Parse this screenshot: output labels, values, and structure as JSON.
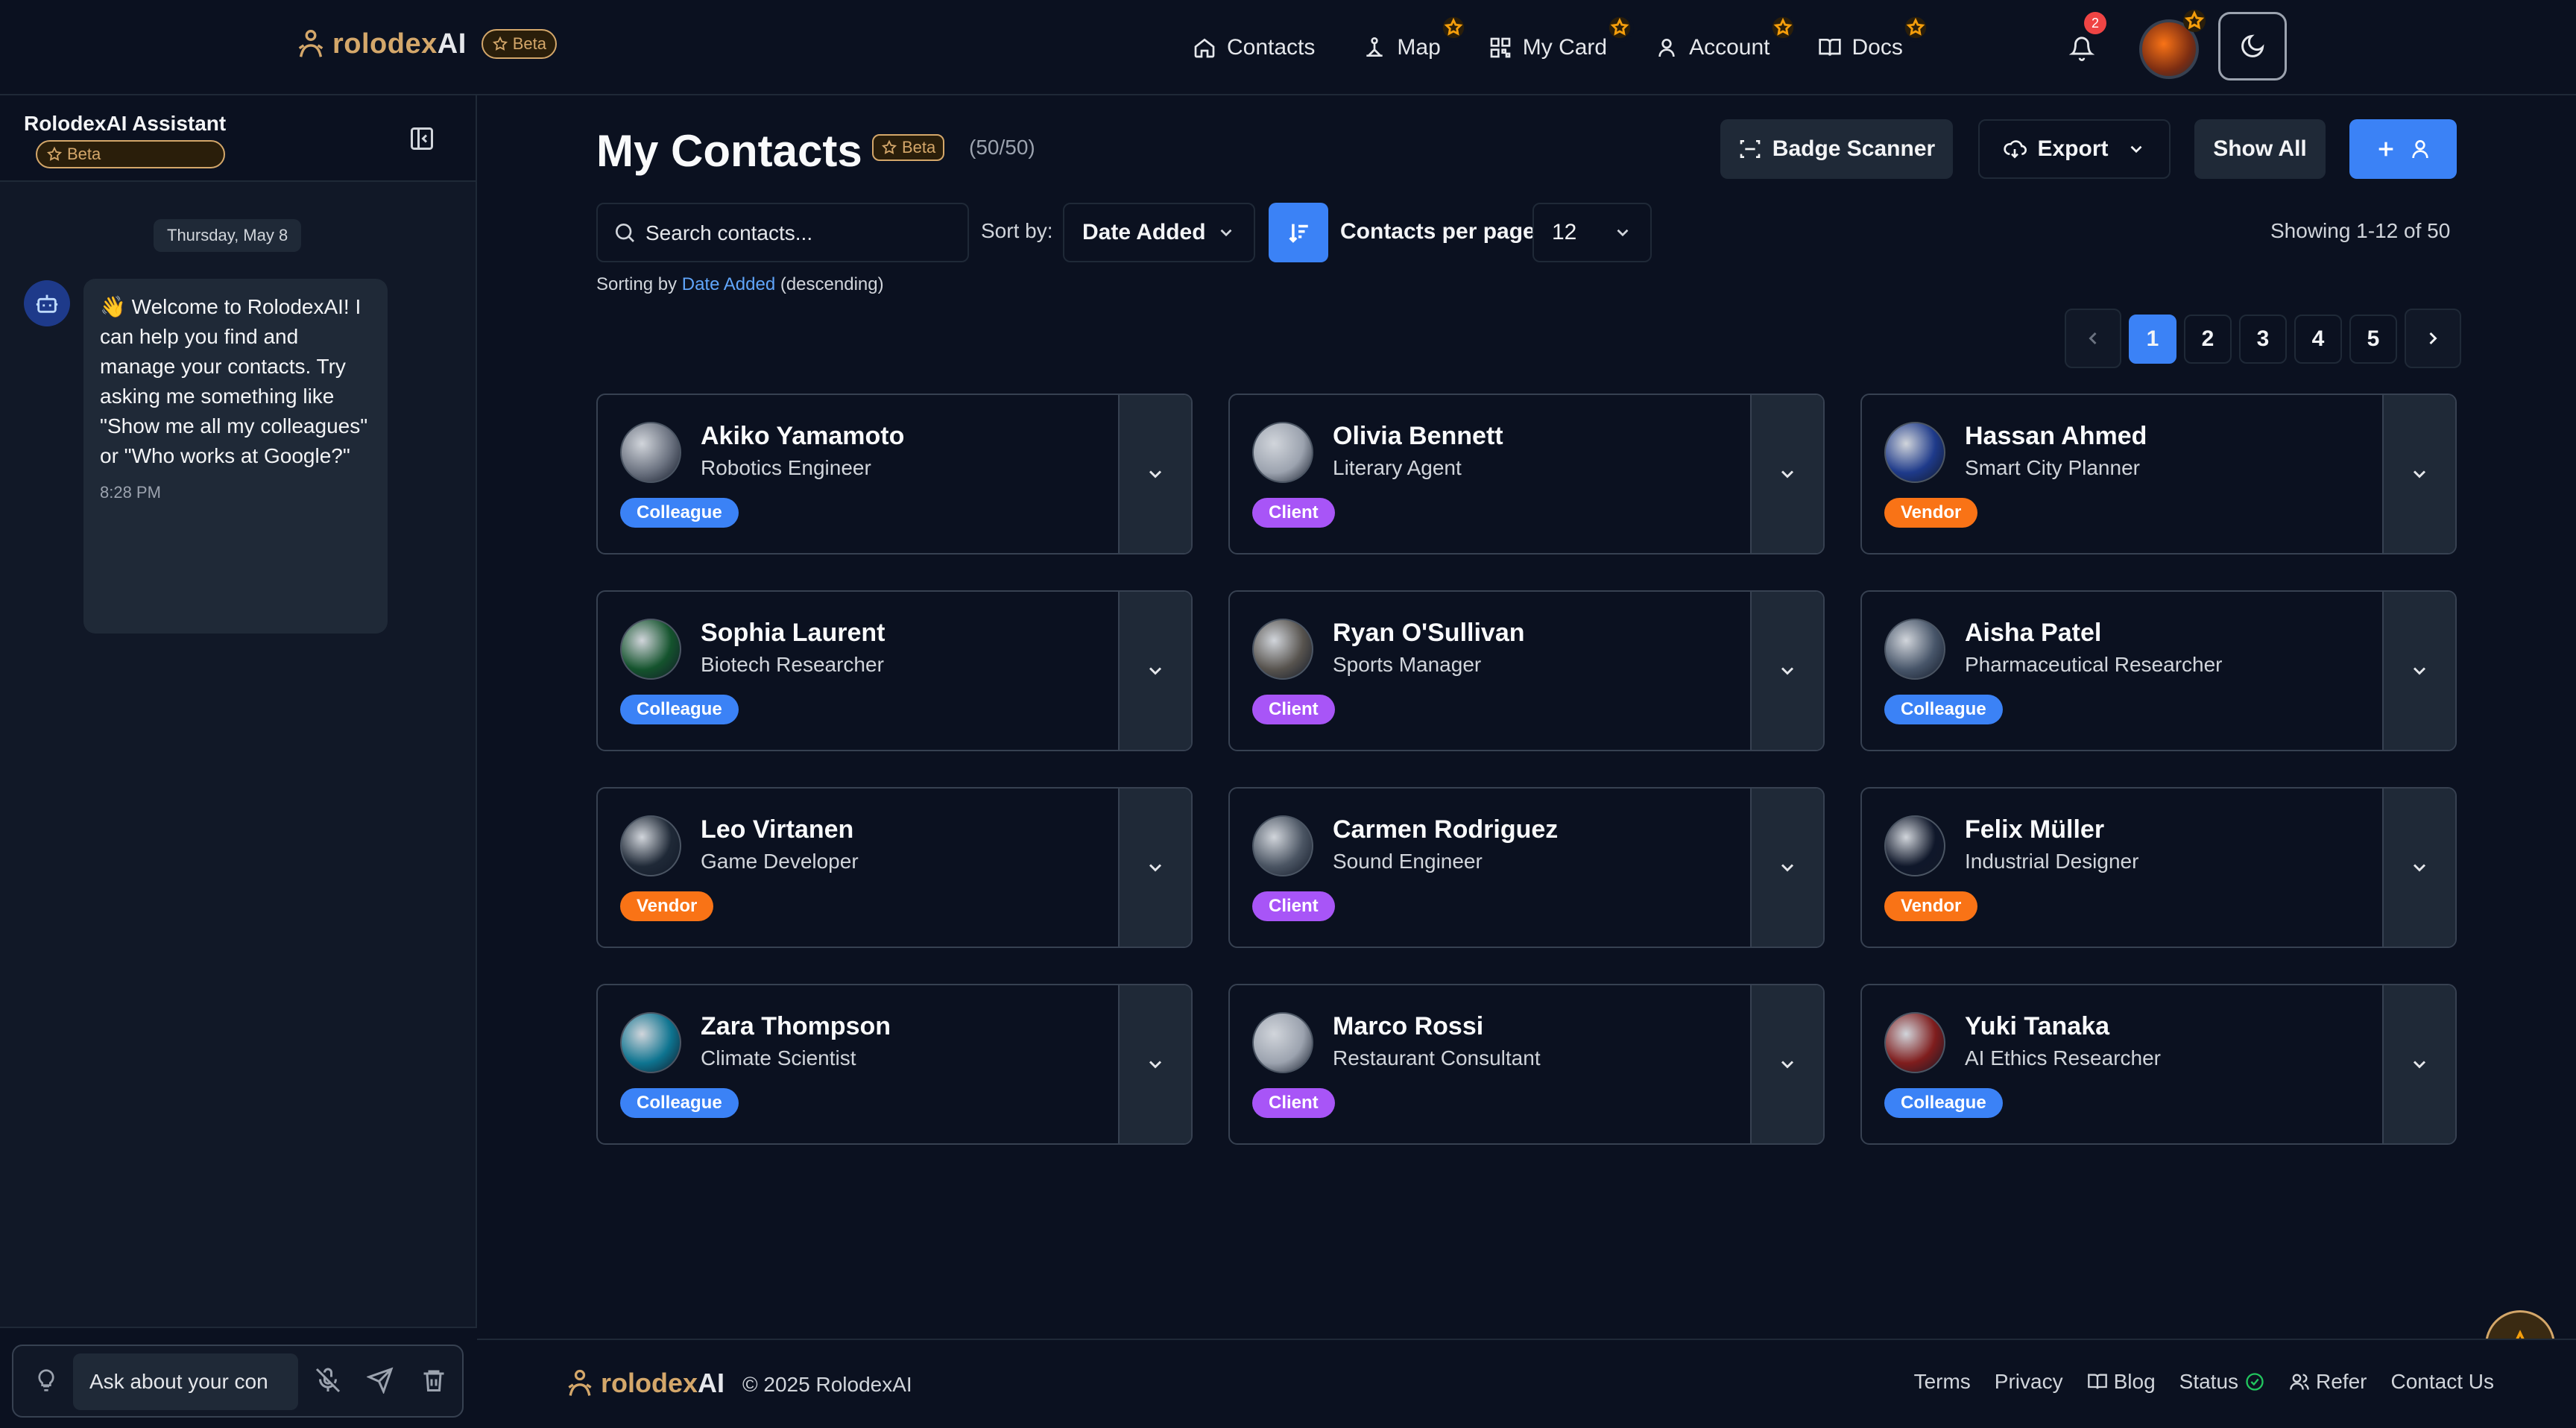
{
  "app": {
    "brand_part1": "rolodex",
    "brand_part2": "AI",
    "beta_label": "Beta"
  },
  "nav": {
    "items": [
      {
        "label": "Contacts",
        "icon": "home-icon",
        "starred": false
      },
      {
        "label": "Map",
        "icon": "map-icon",
        "starred": true
      },
      {
        "label": "My Card",
        "icon": "qr-code-icon",
        "starred": true
      },
      {
        "label": "Account",
        "icon": "user-icon",
        "starred": true
      },
      {
        "label": "Docs",
        "icon": "book-icon",
        "starred": true
      }
    ],
    "notification_count": "2"
  },
  "sidebar": {
    "title": "RolodexAI Assistant",
    "beta_label": "Beta",
    "date_separator": "Thursday, May 8",
    "welcome_message": "👋 Welcome to RolodexAI! I can help you find and manage your contacts. Try asking me something like \"Show me all my colleagues\" or \"Who works at Google?\"",
    "message_time": "8:28 PM",
    "chat_placeholder": "Ask about your con"
  },
  "main": {
    "title": "My Contacts",
    "beta_label": "Beta",
    "count": "(50/50)",
    "badge_scanner_label": "Badge Scanner",
    "export_label": "Export",
    "show_all_label": "Show All",
    "search_placeholder": "Search contacts...",
    "sort_by_label": "Sort by:",
    "sort_value": "Date Added",
    "per_page_label": "Contacts per page",
    "per_page_value": "12",
    "showing_text": "Showing 1-12 of 50",
    "sorting_note_prefix": "Sorting by ",
    "sorting_note_field": "Date Added",
    "sorting_note_suffix": " (descending)",
    "pages": [
      "1",
      "2",
      "3",
      "4",
      "5"
    ],
    "current_page": "1"
  },
  "contacts": [
    {
      "name": "Akiko Yamamoto",
      "role": "Robotics Engineer",
      "tag": "Colleague",
      "avatar_color": "#6b7280"
    },
    {
      "name": "Olivia Bennett",
      "role": "Literary Agent",
      "tag": "Client",
      "avatar_color": "#9ca3af"
    },
    {
      "name": "Hassan Ahmed",
      "role": "Smart City Planner",
      "tag": "Vendor",
      "avatar_color": "#1e3a8a"
    },
    {
      "name": "Sophia Laurent",
      "role": "Biotech Researcher",
      "tag": "Colleague",
      "avatar_color": "#14532d"
    },
    {
      "name": "Ryan O'Sullivan",
      "role": "Sports Manager",
      "tag": "Client",
      "avatar_color": "#57534e"
    },
    {
      "name": "Aisha Patel",
      "role": "Pharmaceutical Researcher",
      "tag": "Colleague",
      "avatar_color": "#475569"
    },
    {
      "name": "Leo Virtanen",
      "role": "Game Developer",
      "tag": "Vendor",
      "avatar_color": "#1f2937"
    },
    {
      "name": "Carmen Rodriguez",
      "role": "Sound Engineer",
      "tag": "Client",
      "avatar_color": "#4b5563"
    },
    {
      "name": "Felix Müller",
      "role": "Industrial Designer",
      "tag": "Vendor",
      "avatar_color": "#0f172a"
    },
    {
      "name": "Zara Thompson",
      "role": "Climate Scientist",
      "tag": "Colleague",
      "avatar_color": "#0e7490"
    },
    {
      "name": "Marco Rossi",
      "role": "Restaurant Consultant",
      "tag": "Client",
      "avatar_color": "#9ca3af"
    },
    {
      "name": "Yuki Tanaka",
      "role": "AI Ethics Researcher",
      "tag": "Colleague",
      "avatar_color": "#7f1d1d"
    }
  ],
  "footer": {
    "brand_part1": "rolodex",
    "brand_part2": "AI",
    "copyright": "© 2025 RolodexAI",
    "links": [
      {
        "label": "Terms",
        "icon": ""
      },
      {
        "label": "Privacy",
        "icon": ""
      },
      {
        "label": "Blog",
        "icon": "book-icon"
      },
      {
        "label": "Status",
        "icon": "check-circle-icon"
      },
      {
        "label": "Refer",
        "icon": "users-icon"
      },
      {
        "label": "Contact Us",
        "icon": ""
      }
    ]
  },
  "colors": {
    "accent": "#3b82f6",
    "brand_gold": "#d4a76a",
    "tag_colleague": "#3b82f6",
    "tag_client": "#a855f7",
    "tag_vendor": "#f97316",
    "star": "#f59e0b"
  }
}
